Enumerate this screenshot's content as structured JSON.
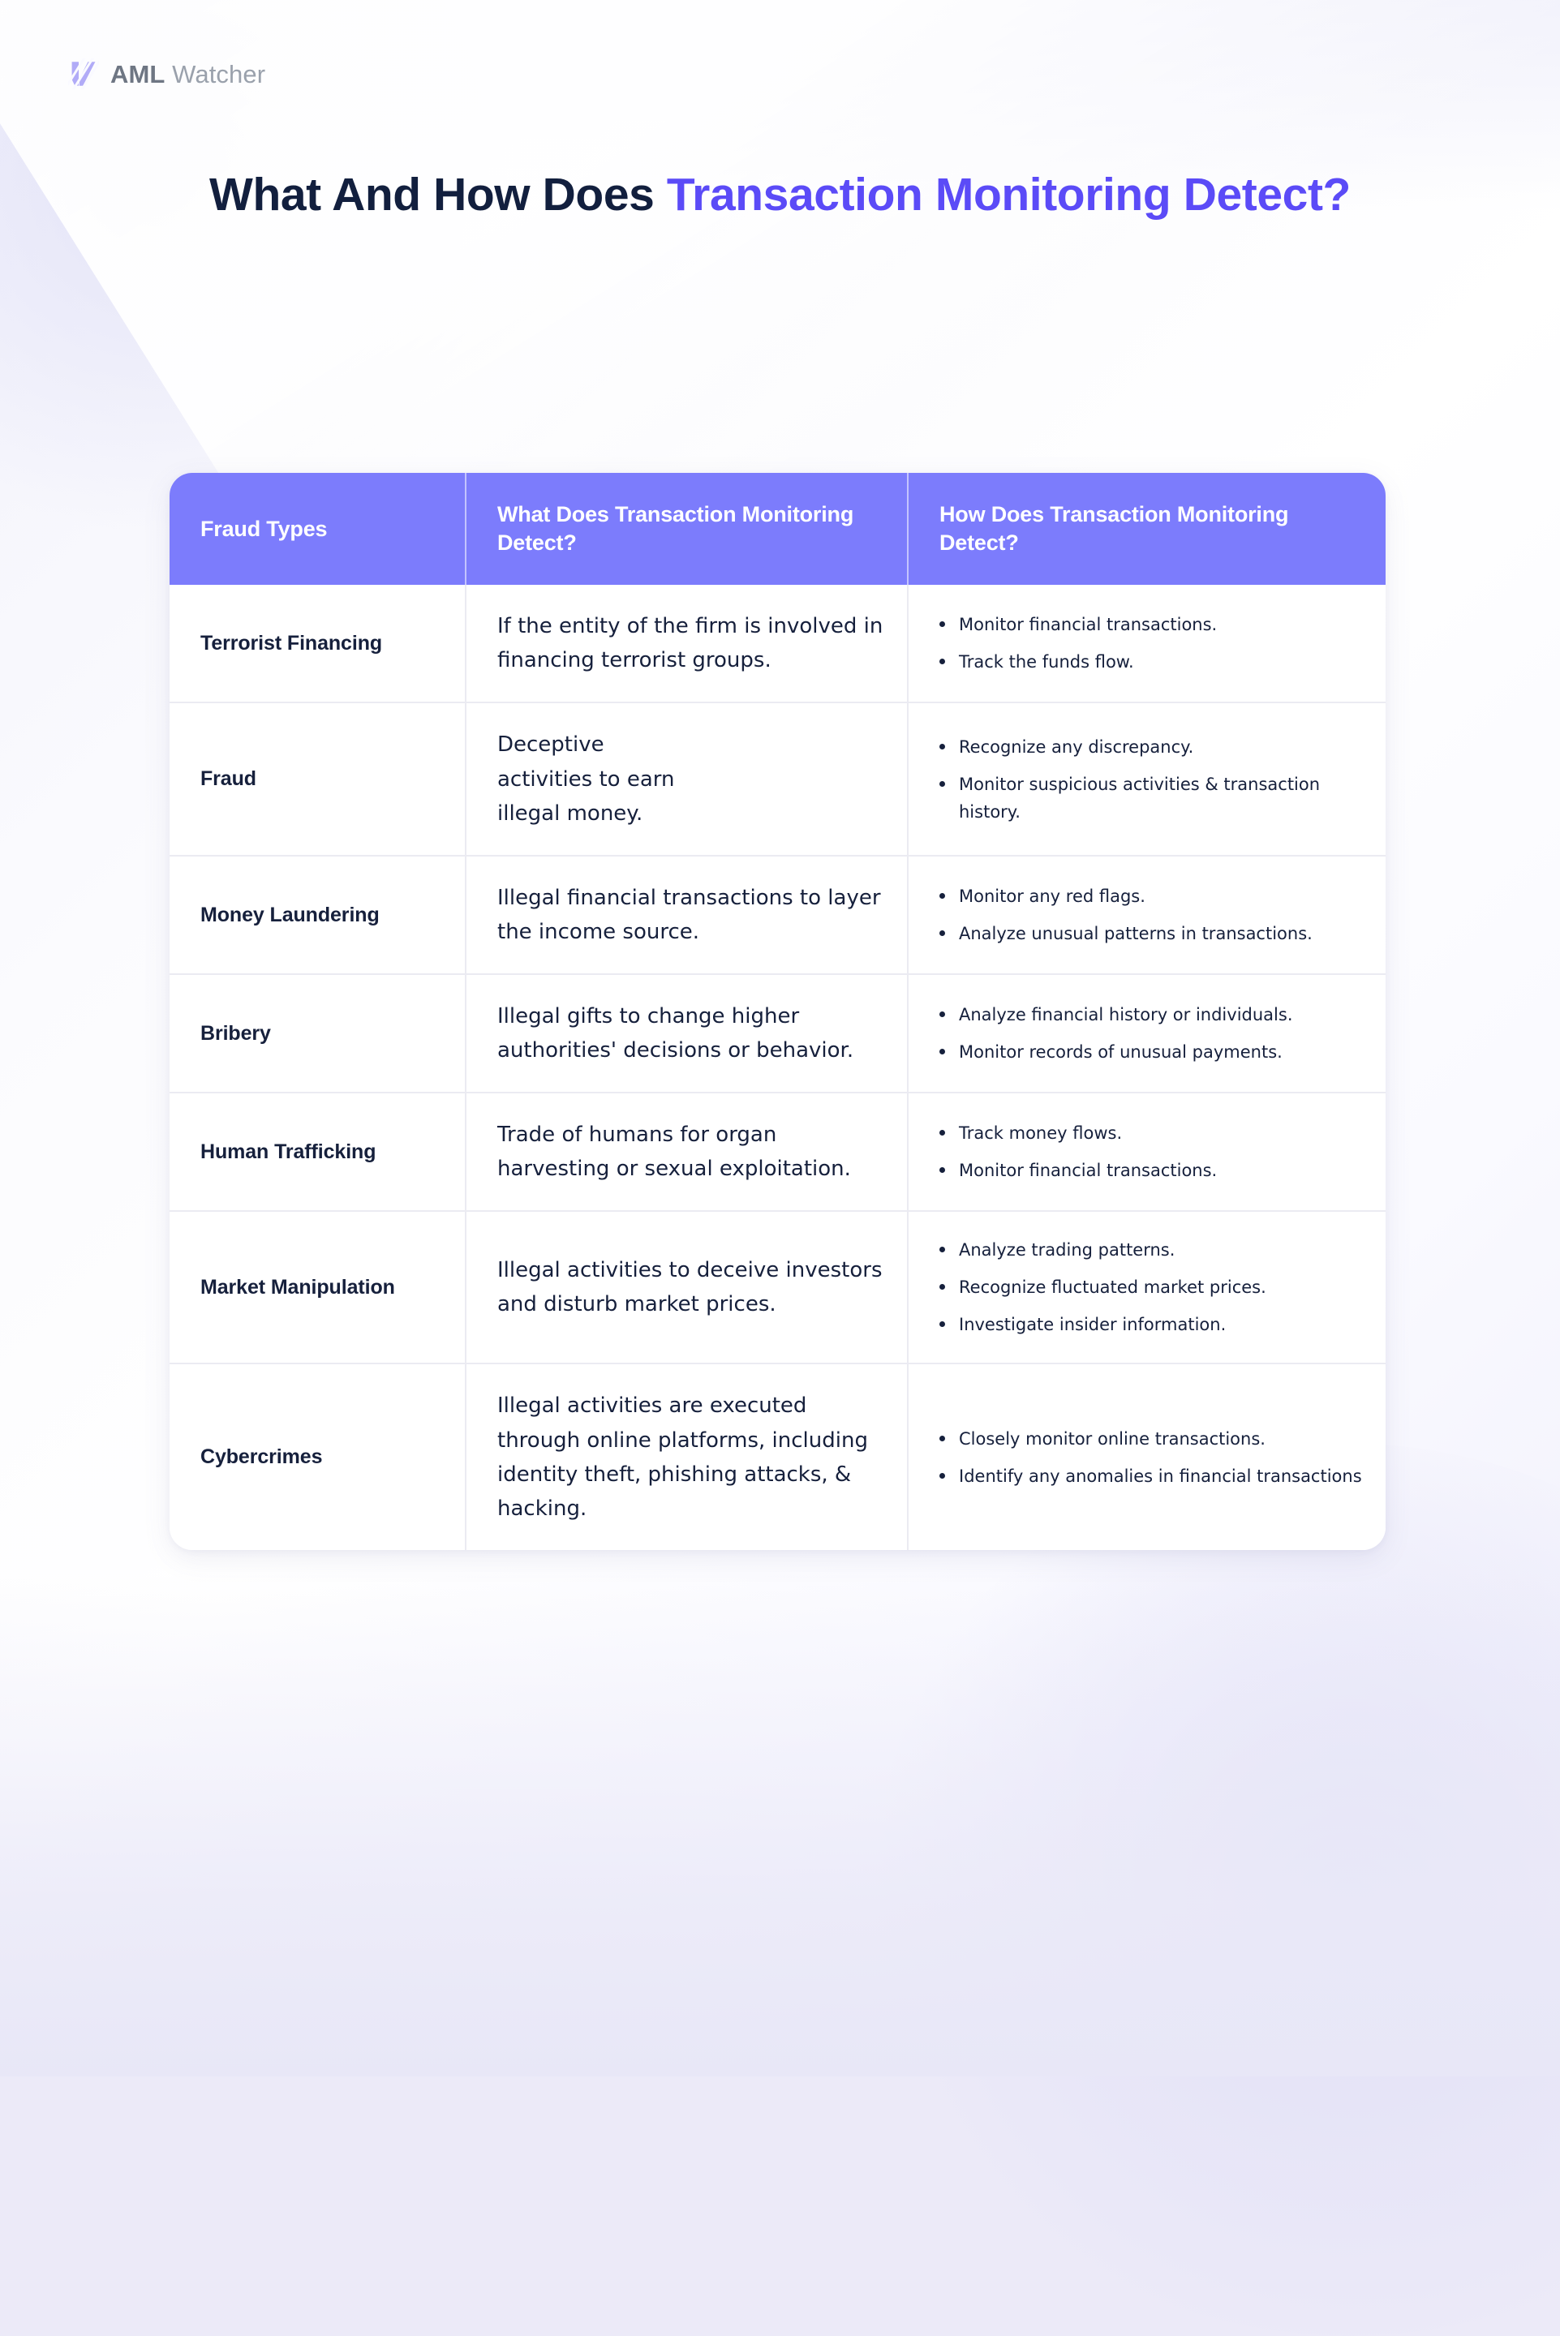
{
  "brand": {
    "logo_icon": "aml-watcher-logo-mark",
    "name_bold": "AML",
    "name_light": " Watcher"
  },
  "header": {
    "title_part1": "What And How Does ",
    "title_part2": "Transaction Monitoring Detect?"
  },
  "colors": {
    "accent_purple": "#7c7cfc",
    "title_purple": "#5b4bf7",
    "title_navy": "#121f3e",
    "body_navy": "#16203c",
    "page_background": "#eceaf8",
    "divider": "#ebebf2"
  },
  "table": {
    "columns": [
      "Fraud Types",
      "What Does Transaction Monitoring Detect?",
      "How Does Transaction Monitoring Detect?"
    ],
    "rows": [
      {
        "fraud_type": "Terrorist Financing",
        "what": "If the entity of the firm is involved in financing terrorist groups.",
        "how": [
          "Monitor financial transactions.",
          "Track the funds flow."
        ]
      },
      {
        "fraud_type": "Fraud",
        "what": "Deceptive\nactivities to earn\nillegal money.",
        "how": [
          "Recognize any discrepancy.",
          "Monitor suspicious activities & transaction history."
        ]
      },
      {
        "fraud_type": "Money Laundering",
        "what": "Illegal financial transactions to layer the income source.",
        "how": [
          "Monitor any red flags.",
          "Analyze unusual patterns in transactions."
        ]
      },
      {
        "fraud_type": "Bribery",
        "what": "Illegal gifts to change higher authorities' decisions or behavior.",
        "how": [
          "Analyze financial history or individuals.",
          "Monitor records of unusual payments."
        ]
      },
      {
        "fraud_type": "Human Trafficking",
        "what": "Trade of humans for organ harvesting or sexual exploitation.",
        "how": [
          "Track money flows.",
          "Monitor financial transactions."
        ]
      },
      {
        "fraud_type": "Market Manipulation",
        "what": "Illegal activities to deceive investors and disturb market prices.",
        "how": [
          "Analyze trading patterns.",
          "Recognize fluctuated market prices.",
          "Investigate insider information."
        ]
      },
      {
        "fraud_type": "Cybercrimes",
        "what": "Illegal activities are executed through online platforms, including identity theft, phishing attacks, & hacking.",
        "how": [
          "Closely monitor online transactions.",
          "Identify any anomalies in financial transactions"
        ]
      }
    ]
  }
}
